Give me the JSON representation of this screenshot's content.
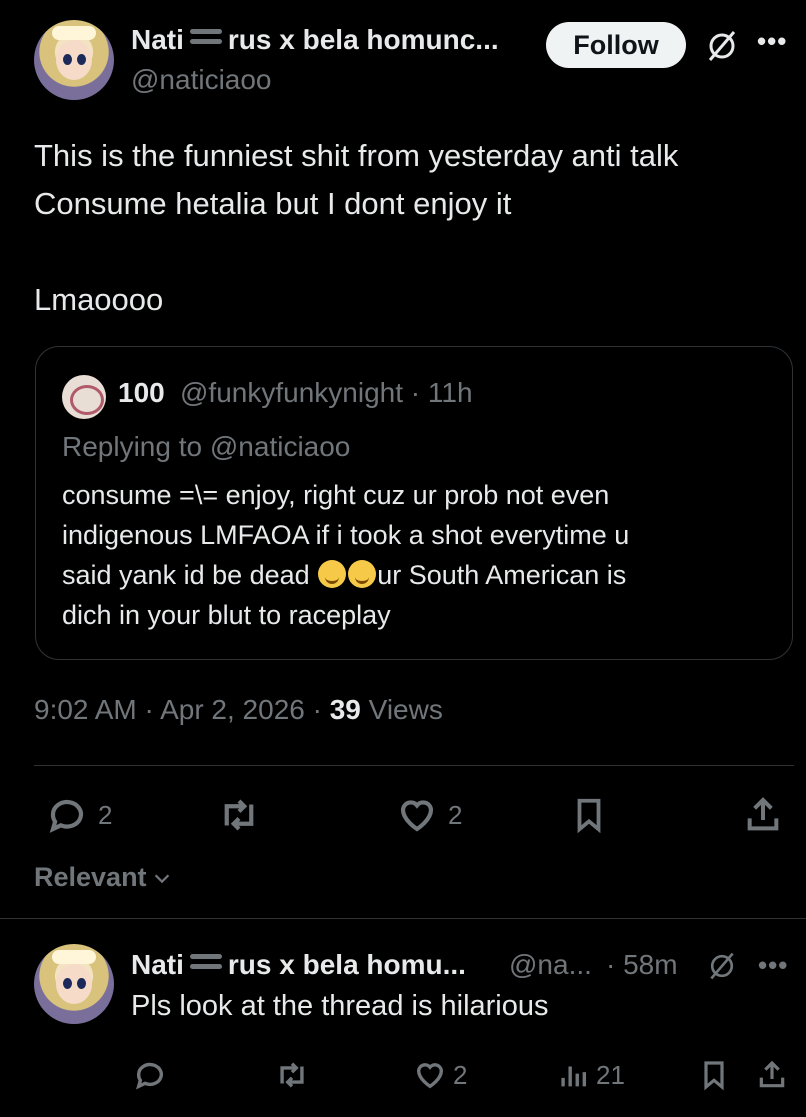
{
  "post": {
    "author_name_a": "Nati",
    "author_name_b": "rus x bela homunc...",
    "author_handle": "@naticiaoo",
    "follow_label": "Follow",
    "text": "This is the funniest shit from yesterday anti talk\nConsume hetalia but I dont enjoy it\n\nLmaoooo",
    "timestamp": "9:02 AM · Apr 2, 2026 · ",
    "views_count": "39",
    "views_label": " Views",
    "replies": "2",
    "likes": "2"
  },
  "quote": {
    "name": "100",
    "handle_time": "@funkyfunkynight · 11h",
    "replying_label": "Replying to ",
    "replying_handle": "@naticiaoo",
    "text_a": "consume =\\= enjoy, right cuz ur prob not even\nindigenous LMFAOA if i took a shot everytime u\nsaid yank id be dead ",
    "text_b": "ur South American is\ndich in your blut to raceplay"
  },
  "sort": {
    "label": "Relevant"
  },
  "reply": {
    "author_name_a": "Nati",
    "author_name_b": "rus x bela homu...",
    "handle": "@na...",
    "time": "· 58m",
    "text": "Pls look at the thread is hilarious",
    "likes": "2",
    "views": "21"
  },
  "icons": {
    "more": "more-icon",
    "grok": "grok-icon",
    "reply": "reply-icon",
    "repost": "repost-icon",
    "like": "heart-icon",
    "bookmark": "bookmark-icon",
    "share": "share-icon",
    "views": "views-icon",
    "chevron": "chevron-down-icon"
  }
}
